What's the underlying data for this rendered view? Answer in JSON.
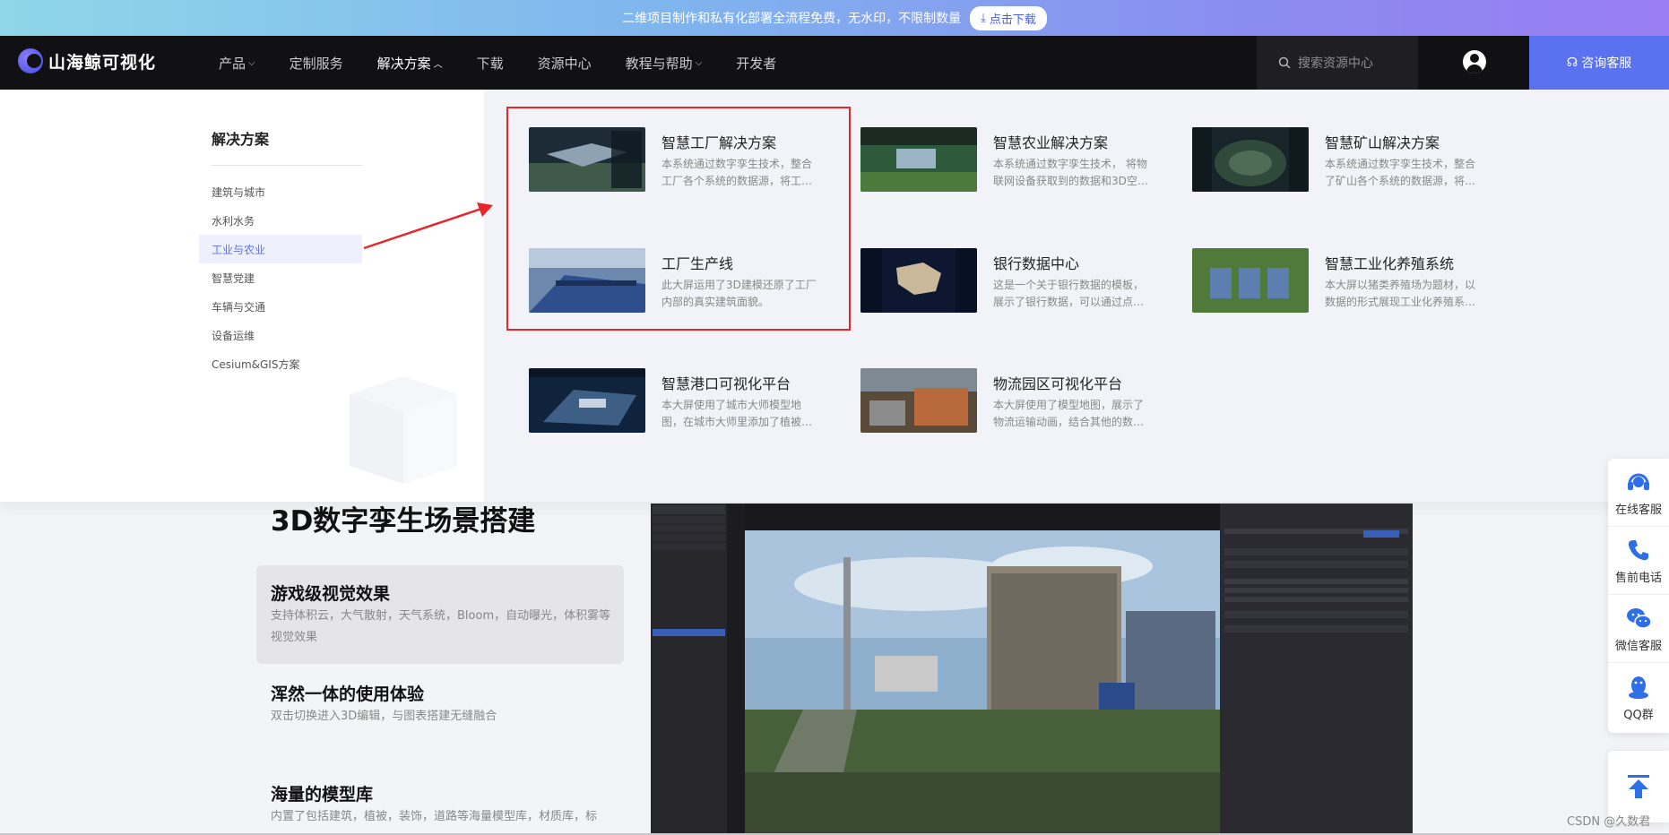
{
  "promo": {
    "text": "二维项目制作和私有化部署全流程免费，无水印，不限制数量",
    "button": "点击下载"
  },
  "nav": {
    "brand": "山海鲸可视化",
    "items": [
      {
        "label": "产品",
        "dropdown": true,
        "active": false
      },
      {
        "label": "定制服务",
        "dropdown": false,
        "active": false
      },
      {
        "label": "解决方案",
        "dropdown": true,
        "active": true
      },
      {
        "label": "下载",
        "dropdown": false,
        "active": false
      },
      {
        "label": "资源中心",
        "dropdown": false,
        "active": false
      },
      {
        "label": "教程与帮助",
        "dropdown": true,
        "active": false
      },
      {
        "label": "开发者",
        "dropdown": false,
        "active": false
      }
    ],
    "search_placeholder": "搜索资源中心",
    "consult": "咨询客服"
  },
  "solutions": {
    "title": "解决方案",
    "categories": [
      {
        "label": "建筑与城市",
        "selected": false
      },
      {
        "label": "水利水务",
        "selected": false
      },
      {
        "label": "工业与农业",
        "selected": true
      },
      {
        "label": "智慧党建",
        "selected": false
      },
      {
        "label": "车辆与交通",
        "selected": false
      },
      {
        "label": "设备运维",
        "selected": false
      },
      {
        "label": "Cesium&GIS方案",
        "selected": false
      }
    ],
    "cards": [
      {
        "title": "智慧工厂解决方案",
        "desc": "本系统通过数字孪生技术，整合工厂各个系统的数据源，将工…"
      },
      {
        "title": "智慧农业解决方案",
        "desc": "本系统通过数字孪生技术， 将物联网设备获取到的数据和3D空…"
      },
      {
        "title": "智慧矿山解决方案",
        "desc": "本系统通过数字孪生技术，整合了矿山各个系统的数据源，将…"
      },
      {
        "title": "工厂生产线",
        "desc": "此大屏运用了3D建模还原了工厂内部的真实建筑面貌。"
      },
      {
        "title": "银行数据中心",
        "desc": "这是一个关于银行数据的模板，展示了银行数据，可以通过点…"
      },
      {
        "title": "智慧工业化养殖系统",
        "desc": "本大屏以猪类养殖场为题材，以数据的形式展现工业化养殖系…"
      },
      {
        "title": "智慧港口可视化平台",
        "desc": "本大屏使用了城市大师模型地图，在城市大师里添加了植被…"
      },
      {
        "title": "物流园区可视化平台",
        "desc": "本大屏使用了模型地图，展示了物流运输动画，结合其他的数…"
      }
    ]
  },
  "content": {
    "heading": "3D数字孪生场景搭建",
    "features": [
      {
        "title": "游戏级视觉效果",
        "desc": "支持体积云，大气散射，天气系统，Bloom，自动曝光，体积雾等视觉效果"
      },
      {
        "title": "浑然一体的使用体验",
        "desc": "双击切换进入3D编辑，与图表搭建无缝融合"
      },
      {
        "title": "海量的模型库",
        "desc": "内置了包括建筑，植被，装饰，道路等海量模型库，材质库，标"
      }
    ]
  },
  "sidebar": {
    "items": [
      {
        "label": "在线客服",
        "icon": "headset-icon"
      },
      {
        "label": "售前电话",
        "icon": "phone-icon"
      },
      {
        "label": "微信客服",
        "icon": "wechat-icon"
      },
      {
        "label": "QQ群",
        "icon": "qq-icon"
      }
    ]
  },
  "watermark": "CSDN @久数君",
  "colors": {
    "accent": "#5b72f0",
    "highlight": "#e5262b",
    "nav_bg": "#111113"
  }
}
